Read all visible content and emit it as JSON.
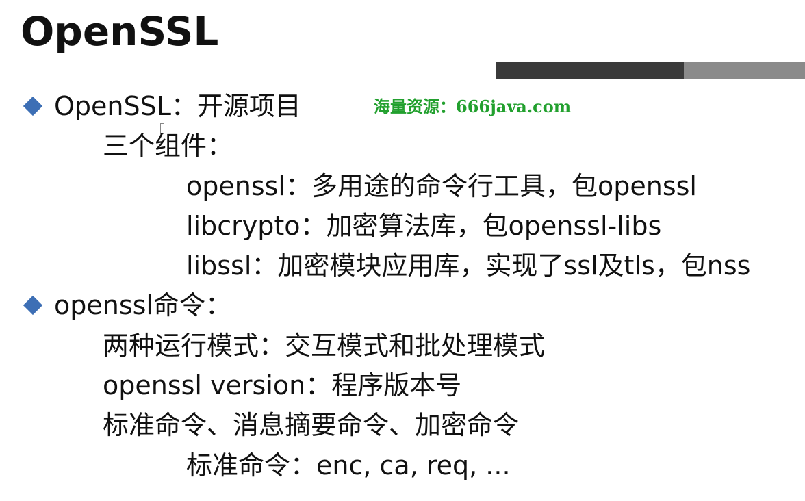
{
  "slide": {
    "title": "OpenSSL",
    "watermark": "海量资源：666java.com",
    "colors": {
      "bullet": "#3d6fb5",
      "watermark": "#22a02e",
      "bar_dark": "#3a3a3a",
      "bar_light": "#8a8a8a"
    },
    "bullets": [
      {
        "text": "OpenSSL：开源项目",
        "children": [
          {
            "text": "三个组件：",
            "children": [
              "openssl：多用途的命令行工具，包openssl",
              "libcrypto：加密算法库，包openssl-libs",
              "libssl：加密模块应用库，实现了ssl及tls，包nss"
            ]
          }
        ]
      },
      {
        "text": "openssl命令：",
        "children": [
          {
            "text": "两种运行模式：交互模式和批处理模式"
          },
          {
            "text": "openssl version：程序版本号"
          },
          {
            "text": "标准命令、消息摘要命令、加密命令",
            "children": [
              "标准命令：enc, ca, req, ..."
            ]
          }
        ]
      }
    ]
  }
}
